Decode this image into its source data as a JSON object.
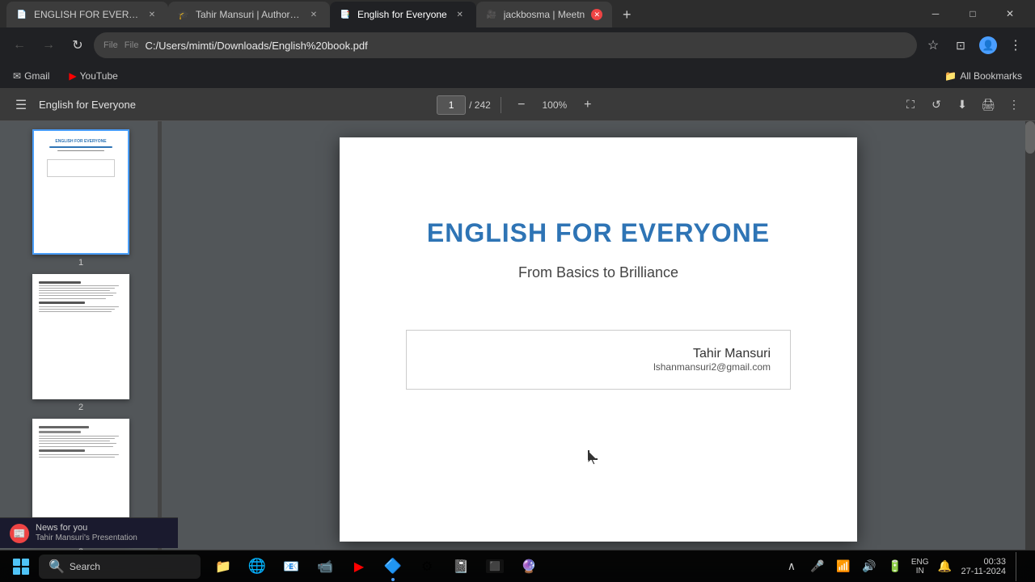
{
  "browser": {
    "tabs": [
      {
        "id": "tab1",
        "title": "ENGLISH FOR EVERYONE From...",
        "favicon": "📄",
        "active": false,
        "has_close": true
      },
      {
        "id": "tab2",
        "title": "Tahir Mansuri | Author | Udemy",
        "favicon": "🎓",
        "active": false,
        "has_close": true
      },
      {
        "id": "tab3",
        "title": "English for Everyone",
        "favicon": "📑",
        "active": true,
        "has_close": true
      },
      {
        "id": "tab4",
        "title": "jackbosma | Meetn",
        "favicon": "🎥",
        "active": false,
        "has_close": true
      }
    ],
    "address": "C:/Users/mimti/Downloads/English%20book.pdf",
    "protocol": "File",
    "bookmarks": [
      {
        "id": "gmail",
        "label": "Gmail",
        "favicon": "✉"
      },
      {
        "id": "youtube",
        "label": "YouTube",
        "favicon": "▶"
      }
    ],
    "all_bookmarks_label": "All Bookmarks"
  },
  "pdf": {
    "title": "English for Everyone",
    "current_page": "1",
    "total_pages": "242",
    "zoom": "100%",
    "page_content": {
      "title": "ENGLISH FOR EVERYONE",
      "subtitle": "From Basics to Brilliance",
      "author_name": "Tahir Mansuri",
      "author_email": "lshanmansuri2@gmail.com"
    },
    "thumbnails": [
      {
        "page": "1",
        "selected": true
      },
      {
        "page": "2",
        "selected": false
      },
      {
        "page": "3",
        "selected": false
      }
    ]
  },
  "taskbar": {
    "search_placeholder": "Search",
    "apps": [
      {
        "id": "file-explorer",
        "icon": "📁"
      },
      {
        "id": "edge",
        "icon": "🌐"
      },
      {
        "id": "mail",
        "icon": "📧"
      },
      {
        "id": "video-call",
        "icon": "📹"
      },
      {
        "id": "youtube-app",
        "icon": "▶"
      },
      {
        "id": "edge2",
        "icon": "🔷"
      },
      {
        "id": "settings",
        "icon": "⚙"
      },
      {
        "id": "onenote",
        "icon": "📓"
      },
      {
        "id": "terminal",
        "icon": "⬛"
      },
      {
        "id": "unknown",
        "icon": "🔮"
      }
    ],
    "system_tray": {
      "lang": "ENG",
      "region": "IN",
      "time": "00:33",
      "date": "27-11-2024"
    }
  },
  "news": {
    "label": "News for you",
    "title": "Tahir Mansuri's Presentation"
  },
  "icons": {
    "menu": "☰",
    "back": "←",
    "forward": "→",
    "reload": "↻",
    "star": "☆",
    "extensions": "⊞",
    "profile": "👤",
    "more": "⋮",
    "lock": "🔒",
    "download": "⬇",
    "print": "🖨",
    "zoom_out": "−",
    "zoom_in": "+",
    "fit_page": "⛶",
    "rotate": "↺",
    "close": "✕",
    "minimize": "─",
    "maximize": "□",
    "search": "🔍",
    "apps_grid": "⊞",
    "wifi": "📶",
    "volume": "🔊",
    "battery": "🔋",
    "show_desktop": "▌",
    "chevron_up": "∧"
  }
}
